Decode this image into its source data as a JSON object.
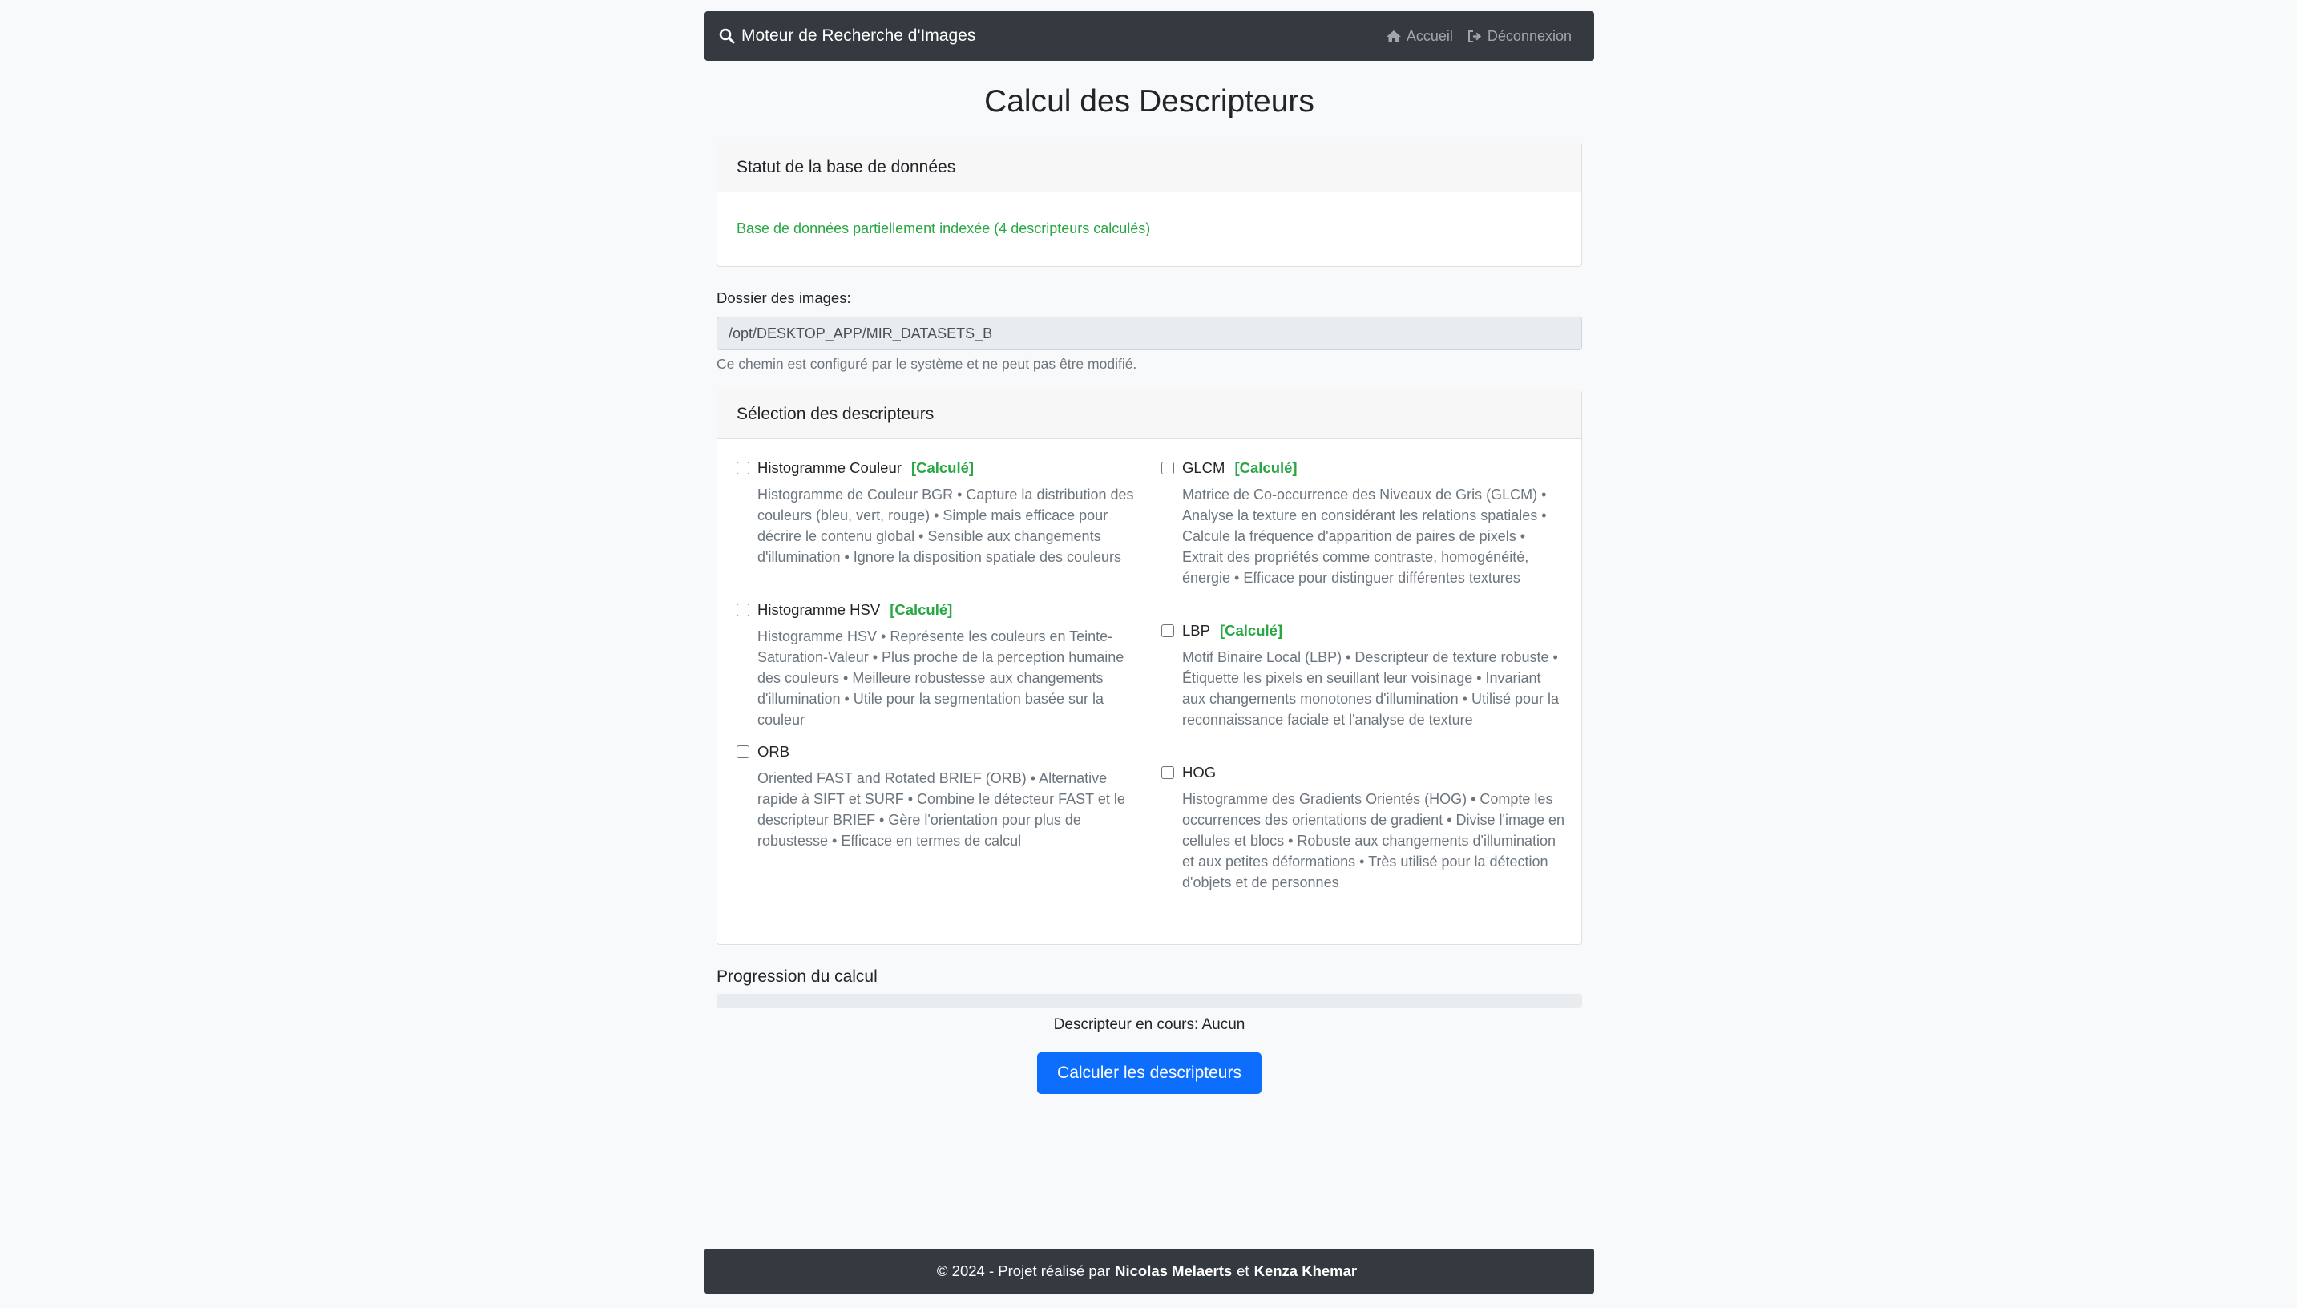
{
  "navbar": {
    "brand": "Moteur de Recherche d'Images",
    "links": [
      {
        "label": "Accueil",
        "icon": "home-icon"
      },
      {
        "label": "Déconnexion",
        "icon": "logout-icon"
      }
    ]
  },
  "page": {
    "title": "Calcul des Descripteurs"
  },
  "status": {
    "header": "Statut de la base de données",
    "message": "Base de données partiellement indexée (4 descripteurs calculés)",
    "message_color": "#28a745"
  },
  "folder": {
    "label": "Dossier des images:",
    "value": "/opt/DESKTOP_APP/MIR_DATASETS_B",
    "help": "Ce chemin est configuré par le système et ne peut pas être modifié."
  },
  "selection": {
    "header": "Sélection des descripteurs",
    "calculated_tag": "[Calculé]",
    "descriptors": [
      {
        "name": "Histogramme Couleur",
        "calculated": true,
        "checked": false,
        "description": "Histogramme de Couleur BGR • Capture la distribution des couleurs (bleu, vert, rouge) • Simple mais efficace pour décrire le contenu global • Sensible aux changements d'illumination • Ignore la disposition spatiale des couleurs"
      },
      {
        "name": "Histogramme HSV",
        "calculated": true,
        "checked": false,
        "description": "Histogramme HSV • Représente les couleurs en Teinte-Saturation-Valeur • Plus proche de la perception humaine des couleurs • Meilleure robustesse aux changements d'illumination • Utile pour la segmentation basée sur la couleur"
      },
      {
        "name": "ORB",
        "calculated": false,
        "checked": false,
        "description": "Oriented FAST and Rotated BRIEF (ORB) • Alternative rapide à SIFT et SURF • Combine le détecteur FAST et le descripteur BRIEF • Gère l'orientation pour plus de robustesse • Efficace en termes de calcul"
      },
      {
        "name": "GLCM",
        "calculated": true,
        "checked": false,
        "description": "Matrice de Co-occurrence des Niveaux de Gris (GLCM) • Analyse la texture en considérant les relations spatiales • Calcule la fréquence d'apparition de paires de pixels • Extrait des propriétés comme contraste, homogénéité, énergie • Efficace pour distinguer différentes textures"
      },
      {
        "name": "LBP",
        "calculated": true,
        "checked": false,
        "description": "Motif Binaire Local (LBP) • Descripteur de texture robuste • Étiquette les pixels en seuillant leur voisinage • Invariant aux changements monotones d'illumination • Utilisé pour la reconnaissance faciale et l'analyse de texture"
      },
      {
        "name": "HOG",
        "calculated": false,
        "checked": false,
        "description": "Histogramme des Gradients Orientés (HOG) • Compte les occurrences des orientations de gradient • Divise l'image en cellules et blocs • Robuste aux changements d'illumination et aux petites déformations • Très utilisé pour la détection d'objets et de personnes"
      }
    ]
  },
  "progress": {
    "label": "Progression du calcul",
    "percent": 0,
    "current_text": "Descripteur en cours: Aucun",
    "accent": "#0d6efd"
  },
  "actions": {
    "compute_label": "Calculer les descripteurs"
  },
  "footer": {
    "prefix": "© 2024 - Projet réalisé par",
    "author1": "Nicolas Melaerts",
    "conjunction": "et",
    "author2": "Kenza Khemar"
  }
}
